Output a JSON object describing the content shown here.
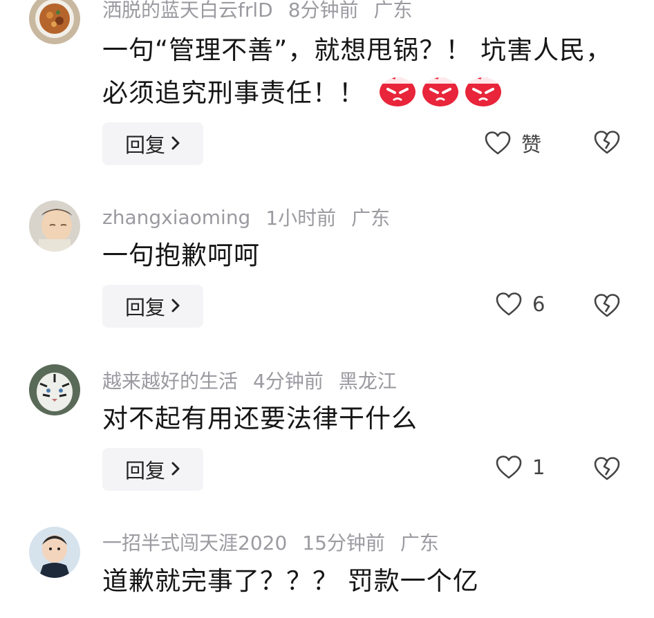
{
  "comments": [
    {
      "username": "洒脱的蓝天白云frlD",
      "time": "8分钟前",
      "location": "广东",
      "text": "一句“管理不善”，就想甩锅？！ 坑害人民，必须追究刑事责任！！",
      "emoji_count": 3,
      "reply_label": "回复",
      "like_label": "赞"
    },
    {
      "username": "zhangxiaoming",
      "time": "1小时前",
      "location": "广东",
      "text": "一句抱歉呵呵",
      "reply_label": "回复",
      "like_label": "6"
    },
    {
      "username": "越来越好的生活",
      "time": "4分钟前",
      "location": "黑龙江",
      "text": "对不起有用还要法律干什么",
      "reply_label": "回复",
      "like_label": "1"
    },
    {
      "username": "一招半式闯天涯2020",
      "time": "15分钟前",
      "location": "广东",
      "text": "道歉就完事了？？？ 罚款一个亿"
    }
  ],
  "icons": {
    "reply_chevron": "chevron-right-icon",
    "like": "heart-outline-icon",
    "dislike": "broken-heart-icon",
    "emoji": "angry-face-emoji"
  },
  "colors": {
    "meta_text": "#9a9aa0",
    "reply_bg": "#f4f4f6",
    "emoji_red": "#e8253a"
  }
}
